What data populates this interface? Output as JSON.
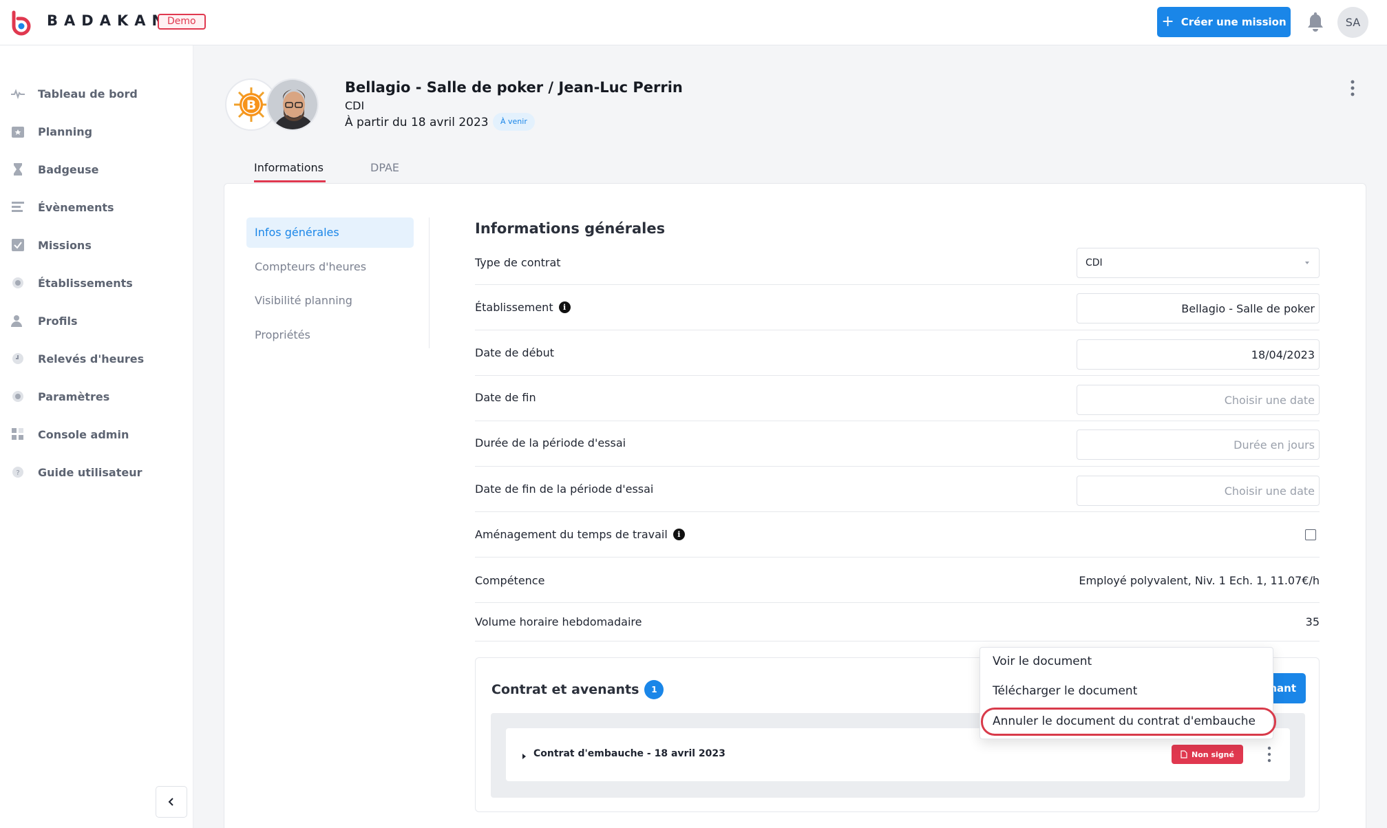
{
  "header": {
    "brand": "BADAKAN",
    "env_badge": "Demo",
    "create_mission_label": "Créer une mission",
    "user_initials": "SA"
  },
  "sidebar": {
    "items": [
      {
        "label": "Tableau de bord",
        "icon": "pulse-icon"
      },
      {
        "label": "Planning",
        "icon": "calendar-icon"
      },
      {
        "label": "Badgeuse",
        "icon": "hourglass-icon"
      },
      {
        "label": "Évènements",
        "icon": "list-icon"
      },
      {
        "label": "Missions",
        "icon": "checklist-icon"
      },
      {
        "label": "Établissements",
        "icon": "building-icon"
      },
      {
        "label": "Profils",
        "icon": "user-icon"
      },
      {
        "label": "Relevés d'heures",
        "icon": "clock-icon"
      },
      {
        "label": "Paramètres",
        "icon": "gear-icon"
      },
      {
        "label": "Console admin",
        "icon": "grid-icon"
      },
      {
        "label": "Guide utilisateur",
        "icon": "help-icon"
      }
    ]
  },
  "profile": {
    "title": "Bellagio - Salle de poker / Jean-Luc Perrin",
    "contract_type": "CDI",
    "start_text": "À partir du 18 avril 2023",
    "status": "À venir"
  },
  "tabs": [
    {
      "label": "Informations",
      "active": true
    },
    {
      "label": "DPAE",
      "active": false
    }
  ],
  "subnav": [
    {
      "label": "Infos générales",
      "active": true
    },
    {
      "label": "Compteurs d'heures",
      "active": false
    },
    {
      "label": "Visibilité planning",
      "active": false
    },
    {
      "label": "Propriétés",
      "active": false
    }
  ],
  "general_info": {
    "title": "Informations générales",
    "contract_type_label": "Type de contrat",
    "contract_type_value": "CDI",
    "establishment_label": "Établissement",
    "establishment_value": "Bellagio - Salle de poker",
    "start_date_label": "Date de début",
    "start_date_value": "18/04/2023",
    "end_date_label": "Date de fin",
    "end_date_placeholder": "Choisir une date",
    "trial_duration_label": "Durée de la période d'essai",
    "trial_duration_placeholder": "Durée en jours",
    "trial_end_label": "Date de fin de la période d'essai",
    "trial_end_placeholder": "Choisir une date",
    "work_time_label": "Aménagement du temps de travail",
    "work_time_checked": false,
    "skill_label": "Compétence",
    "skill_value": "Employé polyvalent, Niv. 1 Ech. 1, 11.07€/h",
    "weekly_hours_label": "Volume horaire hebdomadaire",
    "weekly_hours_value": "35"
  },
  "contracts": {
    "title": "Contrat et avenants",
    "count": "1",
    "add_button_partial": "nant",
    "items": [
      {
        "name": "Contrat d'embauche - 18 avril 2023",
        "status": "Non signé"
      }
    ]
  },
  "context_menu": {
    "items": [
      "Voir le document",
      "Télécharger le document",
      "Annuler le document du contrat d'embauche"
    ]
  },
  "colors": {
    "accent": "#1a86e8",
    "brand_red": "#e0384f"
  }
}
